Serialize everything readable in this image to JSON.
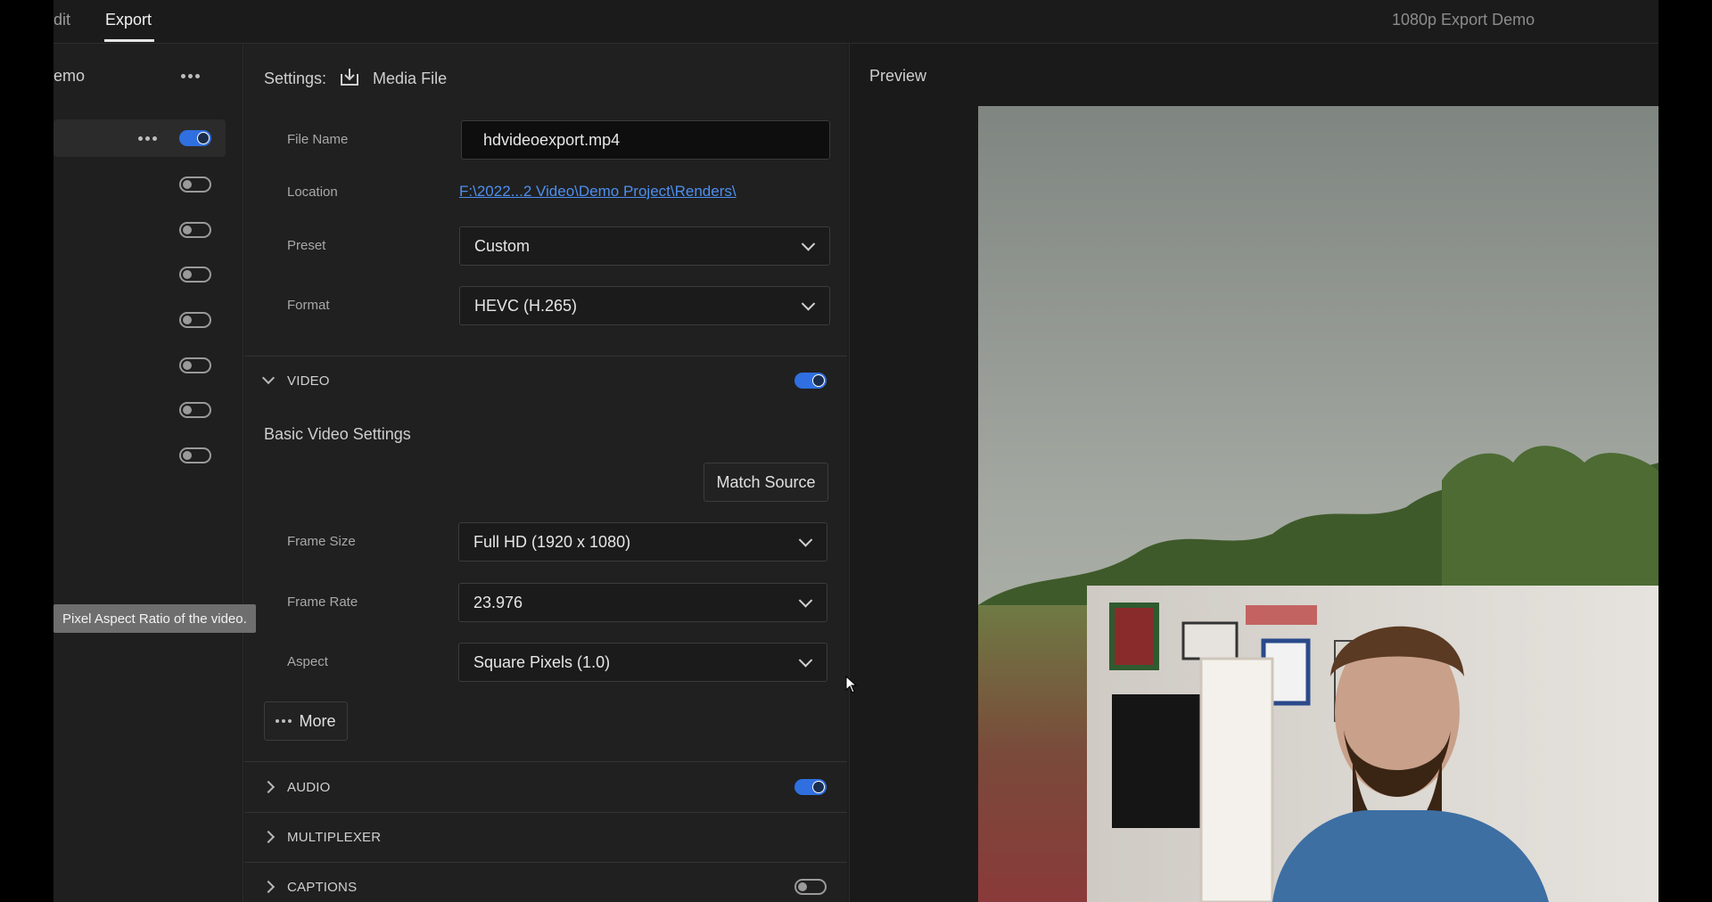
{
  "topbar": {
    "tab_edit": "dit",
    "tab_export": "Export",
    "document_title": "1080p Export Demo"
  },
  "left_panel": {
    "title": "emo",
    "rows": [
      {
        "enabled": true
      },
      {
        "enabled": false
      },
      {
        "enabled": false
      },
      {
        "enabled": false
      },
      {
        "enabled": false
      },
      {
        "enabled": false
      },
      {
        "enabled": false
      },
      {
        "enabled": false
      }
    ]
  },
  "settings": {
    "heading": "Settings:",
    "destination_icon": "export-icon",
    "destination_label": "Media File",
    "file_name_label": "File Name",
    "file_name_value": "hdvideoexport.mp4",
    "location_label": "Location",
    "location_value": "F:\\2022...2 Video\\Demo Project\\Renders\\",
    "preset_label": "Preset",
    "preset_value": "Custom",
    "format_label": "Format",
    "format_value": "HEVC (H.265)"
  },
  "video": {
    "section_label": "VIDEO",
    "enabled": true,
    "subheading": "Basic Video Settings",
    "match_source_label": "Match Source",
    "frame_size_label": "Frame Size",
    "frame_size_value": "Full HD (1920 x 1080)",
    "frame_rate_label": "Frame Rate",
    "frame_rate_value": "23.976",
    "aspect_label": "Aspect",
    "aspect_value": "Square Pixels (1.0)",
    "more_label": "More",
    "tooltip": "Pixel Aspect Ratio of the video."
  },
  "sections": {
    "audio_label": "AUDIO",
    "audio_enabled": true,
    "multiplexer_label": "MULTIPLEXER",
    "captions_label": "CAPTIONS",
    "captions_enabled": false
  },
  "preview": {
    "title": "Preview"
  },
  "colors": {
    "accent": "#2f6fe0",
    "link": "#4d8ff0",
    "panel": "#202020"
  }
}
